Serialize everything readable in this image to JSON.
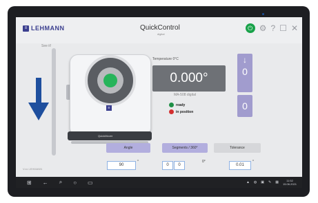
{
  "app": {
    "logo_text": "LEHMANN",
    "logo_mark": "≡",
    "title": "QuickControl",
    "subtitle": "digital"
  },
  "window_controls": {
    "power_icon": "⏻",
    "settings_icon": "⚙",
    "help_icon": "?",
    "maximize_icon": "☐",
    "close_icon": "✕"
  },
  "device": {
    "see_label": "See it!",
    "badge": "≡",
    "base_label": "QuickMover",
    "arrow_direction": "down"
  },
  "readout": {
    "label": "Temperature 0°C",
    "value": "0.000°",
    "model": "MA-508 digital"
  },
  "side_buttons": {
    "arrow": "↓",
    "number": "0",
    "zero": "0"
  },
  "status": [
    {
      "label": "ready",
      "color": "#1f8f46"
    },
    {
      "label": "in position",
      "color": "#d32f2f"
    }
  ],
  "controls": {
    "angle_label": "Angle",
    "segments_label": "Segments / 360°",
    "tolerance_label": "Tolerance",
    "angle_value": "90",
    "angle_unit": "°",
    "segments_value_a": "0",
    "segments_value_b": "0",
    "segments_unit": "0°",
    "tolerance_value": "0.01",
    "tolerance_unit": "°"
  },
  "footer": {
    "version": "V.xx LEHMANN"
  },
  "taskbar": {
    "icons": [
      "⊞",
      "←",
      "⌕",
      "○",
      "▭"
    ],
    "tray": [
      "▲",
      "◍",
      "▣",
      "✎",
      "▦"
    ],
    "time": "11:52",
    "date": "15.06.2021"
  }
}
